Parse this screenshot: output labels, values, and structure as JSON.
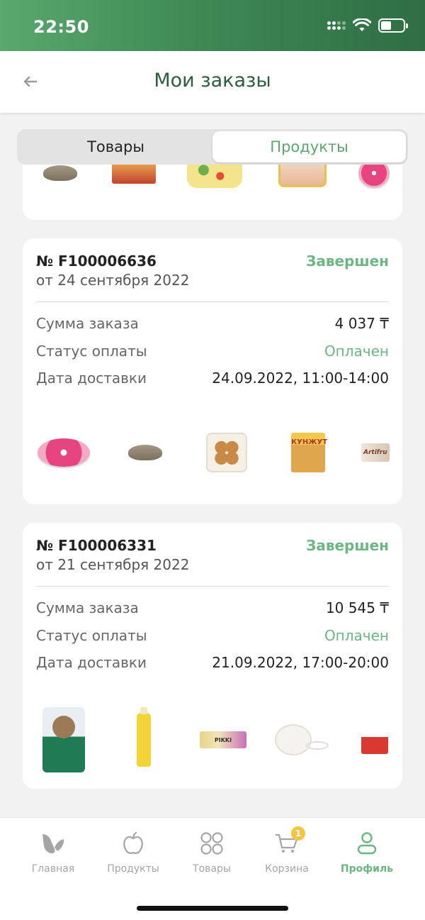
{
  "status_bar": {
    "time": "22:50"
  },
  "header": {
    "title": "Мои заказы"
  },
  "segment": {
    "tab_goods": "Товары",
    "tab_products": "Продукты",
    "active": "Продукты"
  },
  "orders": [
    {
      "number": "№ F100006636",
      "date": "от 24 сентября 2022",
      "status": "Завершен",
      "sum_label": "Сумма заказа",
      "sum_value": "4 037 ₸",
      "payment_label": "Статус оплаты",
      "payment_value": "Оплачен",
      "delivery_label": "Дата доставки",
      "delivery_value": "24.09.2022, 11:00-14:00",
      "items": [
        "donut",
        "croissant",
        "burger-buns",
        "sesame-snack",
        "artifruit-bar"
      ]
    },
    {
      "number": "№ F100006331",
      "date": "от 21 сентября 2022",
      "status": "Завершен",
      "sum_label": "Сумма заказа",
      "sum_value": "10 545 ₸",
      "payment_label": "Статус оплаты",
      "payment_value": "Оплачен",
      "delivery_label": "Дата доставки",
      "delivery_value": "21.09.2022, 17:00-20:00",
      "items": [
        "cat-food",
        "detergent-bottle",
        "pikki-bar",
        "baby-pacifier",
        "red-box"
      ]
    }
  ],
  "product_labels": {
    "sesame": "КУНЖУТ",
    "artifruit": "Artifru",
    "pikki": "PIKKI"
  },
  "bottom_nav": {
    "home": "Главная",
    "products": "Продукты",
    "goods": "Товары",
    "cart": "Корзина",
    "cart_badge": "1",
    "profile": "Профиль",
    "active": "Профиль"
  },
  "colors": {
    "accent": "#6cb683",
    "title": "#2c5e3c",
    "status_bar": "#3f8a55",
    "badge": "#f4c542"
  }
}
